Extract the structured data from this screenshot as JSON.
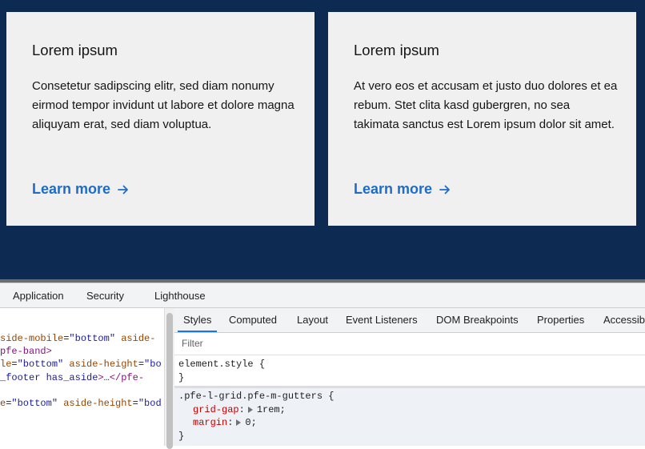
{
  "cards": [
    {
      "title": "Lorem ipsum",
      "body": "Consetetur sadipscing elitr, sed diam nonumy eirmod tempor invidunt ut labore et dolore magna aliquyam erat, sed diam voluptua.",
      "link": "Learn more",
      "link_icon": "arrow-right-icon"
    },
    {
      "title": "Lorem ipsum",
      "body": "At vero eos et accusam et justo duo dolores et ea rebum. Stet clita kasd gubergren, no sea takimata sanctus est Lorem ipsum dolor sit amet.",
      "link": "Learn more",
      "link_icon": "arrow-right-icon"
    }
  ],
  "devtools": {
    "main_tabs": [
      "Application",
      "Security",
      "Lighthouse"
    ],
    "sub_tabs": [
      "Styles",
      "Computed",
      "Layout",
      "Event Listeners",
      "DOM Breakpoints",
      "Properties",
      "Accessibility"
    ],
    "active_sub_tab": "Styles",
    "filter_placeholder": "Filter",
    "elements_lines": [
      {
        "parts": [
          {
            "t": "attr",
            "v": "side-mobile"
          },
          {
            "t": "plain",
            "v": "="
          },
          {
            "t": "val",
            "v": "\"bottom\""
          },
          {
            "t": "plain",
            "v": " "
          },
          {
            "t": "attr",
            "v": "aside-"
          }
        ]
      },
      {
        "parts": [
          {
            "t": "tag",
            "v": "pfe-band>"
          }
        ]
      },
      {
        "parts": [
          {
            "t": "attr",
            "v": "le"
          },
          {
            "t": "plain",
            "v": "="
          },
          {
            "t": "val",
            "v": "\"bottom\""
          },
          {
            "t": "plain",
            "v": " "
          },
          {
            "t": "attr",
            "v": "aside-height"
          },
          {
            "t": "plain",
            "v": "="
          },
          {
            "t": "val",
            "v": "\"bo"
          }
        ]
      },
      {
        "parts": [
          {
            "t": "val",
            "v": "_footer has_aside"
          },
          {
            "t": "tag",
            "v": ">"
          },
          {
            "t": "plain",
            "v": "…"
          },
          {
            "t": "tag",
            "v": "</pfe-"
          }
        ]
      },
      {
        "parts": [
          {
            "t": "attr",
            "v": "e"
          },
          {
            "t": "plain",
            "v": "="
          },
          {
            "t": "val",
            "v": "\"bottom\""
          },
          {
            "t": "plain",
            "v": " "
          },
          {
            "t": "attr",
            "v": "aside-height"
          },
          {
            "t": "plain",
            "v": "="
          },
          {
            "t": "val",
            "v": "\"bod"
          }
        ]
      }
    ],
    "rules": {
      "element_style": {
        "selector": "element.style {",
        "close": "}"
      },
      "grid_rule": {
        "selector": ".pfe-l-grid.pfe-m-gutters {",
        "props": [
          {
            "name": "grid-gap",
            "value": "1rem;"
          },
          {
            "name": "margin",
            "value": "0;"
          }
        ],
        "close": "}"
      }
    }
  },
  "colors": {
    "band": "#0d2b52",
    "card": "#f0f0f0",
    "link": "#1f6cc6",
    "active_tab_underline": "#1a73e8"
  }
}
